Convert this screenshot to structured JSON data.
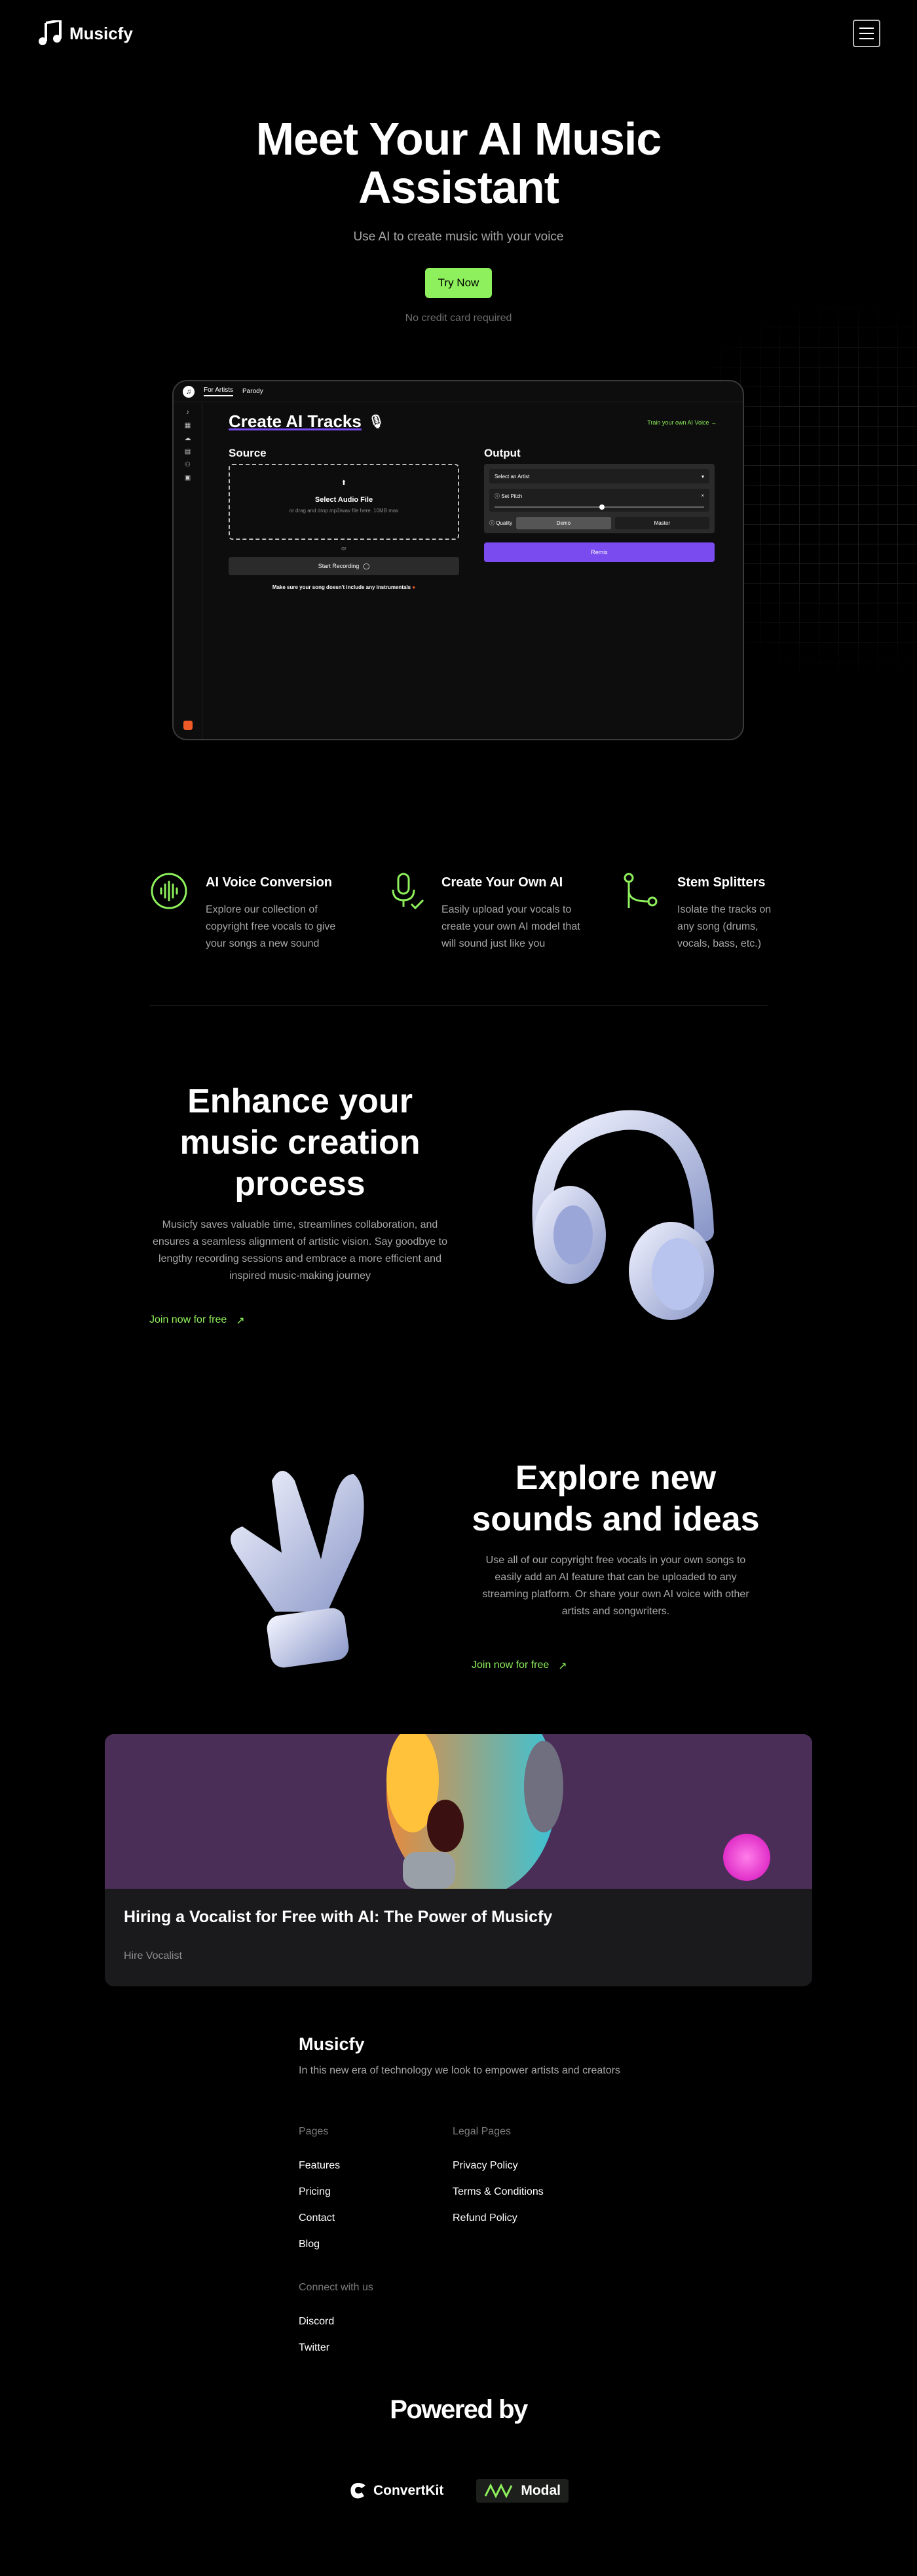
{
  "nav": {
    "brand": "Musicfy",
    "logo_icon": "music-note-icon",
    "menu_icon": "hamburger-menu-icon"
  },
  "hero": {
    "title": "Meet Your AI Music Assistant",
    "subtitle": "Use AI to create music with your voice",
    "cta": "Try Now",
    "note": "No credit card required"
  },
  "app": {
    "tabs": [
      "For Artists",
      "Parody"
    ],
    "title": "Create AI Tracks",
    "train_link": "Train your own AI Voice",
    "source": {
      "heading": "Source",
      "select_label": "Select Audio File",
      "select_hint": "or drag and drop mp3/wav file here. 10MB max",
      "or": "or",
      "record": "Start Recording",
      "warning": "Make sure your song doesn't include any instrumentals"
    },
    "output": {
      "heading": "Output",
      "artist_placeholder": "Select an Artist",
      "pitch_label": "Set Pitch",
      "pitch_level": 0.5,
      "quality_label": "Quality",
      "quality_options": [
        "Demo",
        "Master"
      ],
      "quality_selected": "Demo",
      "remix": "Remix"
    }
  },
  "features": [
    {
      "icon": "sound-wave-icon",
      "title": "AI Voice Conversion",
      "text": "Explore our collection of copyright free vocals to give your songs a new sound"
    },
    {
      "icon": "microphone-check-icon",
      "title": "Create Your Own AI",
      "text": "Easily upload your vocals to create your own AI model that will sound just like you"
    },
    {
      "icon": "branch-split-icon",
      "title": "Stem Splitters",
      "text": "Isolate the tracks on any song (drums, vocals, bass, etc.)"
    }
  ],
  "enhance": {
    "title": "Enhance your music creation process",
    "text": "Musicfy saves valuable time, streamlines collaboration, and ensures a seamless alignment of artistic vision. Say goodbye to lengthy recording sessions and embrace a more efficient and inspired music-making journey",
    "link": "Join now for free"
  },
  "explore": {
    "title": "Explore new sounds and ideas",
    "text": "Use all of our copyright free vocals in your own songs to easily add an AI feature that can be uploaded to any streaming platform. Or share your own AI voice with other artists and songwriters.",
    "link": "Join now for free"
  },
  "card": {
    "title": "Hiring a Vocalist for Free with AI: The Power of Musicfy",
    "tag": "Hire Vocalist"
  },
  "footer": {
    "brand": "Musicfy",
    "desc": "In this new era of technology we look to empower artists and creators",
    "pages_heading": "Pages",
    "pages": [
      "Features",
      "Pricing",
      "Contact",
      "Blog"
    ],
    "legal_heading": "Legal Pages",
    "legal": [
      "Privacy Policy",
      "Terms & Conditions",
      "Refund Policy"
    ],
    "connect_heading": "Connect with us",
    "connect": [
      "Discord",
      "Twitter"
    ]
  },
  "powered": {
    "title": "Powered by",
    "sponsors": [
      "ConvertKit",
      "Modal"
    ]
  },
  "colors": {
    "accent": "#8ef05c",
    "purple": "#7a4cf0"
  }
}
